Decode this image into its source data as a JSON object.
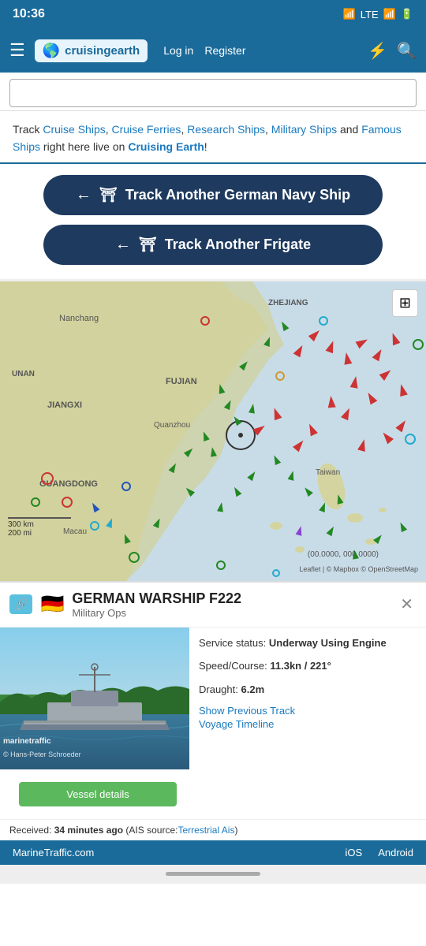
{
  "statusBar": {
    "time": "10:36",
    "bluetooth": "⁸",
    "lte": "LTE",
    "signal": "📶",
    "battery": "🔋"
  },
  "navbar": {
    "logo_text": "cruisingearth",
    "login": "Log in",
    "register": "Register"
  },
  "trackingSection": {
    "prefix": "Track ",
    "links": [
      "Cruise Ships",
      "Cruise Ferries",
      "Research Ships",
      "Military Ships",
      "Famous Ships"
    ],
    "suffix": " right here live on ",
    "brand": "Cruising Earth",
    "postfix": "!"
  },
  "buttons": {
    "german_navy": "Track Another German Navy Ship",
    "frigate": "Track Another Frigate"
  },
  "map": {
    "grid_label": "⊞",
    "scale_300km": "300 km",
    "scale_200mi": "200 mi",
    "coords": "(00.0000, 000.0000)",
    "attribution": "Leaflet | © Mapbox © OpenStreetMap",
    "labels": {
      "nanchang": "Nanchang",
      "zhejiang": "ZHEJIANG",
      "unan": "UNAN",
      "jiangxi": "JIANGXI",
      "fujian": "FUJIAN",
      "guangdong": "GUANGDONG",
      "quanzhou": "Quanzhou",
      "taiwan": "Taiwan",
      "macau": "Macau"
    }
  },
  "ship": {
    "name": "GERMAN WARSHIP F222",
    "category": "Military Ops",
    "service_label": "Service status:",
    "service_value": "Underway Using Engine",
    "speed_label": "Speed/Course:",
    "speed_value": "11.3kn / 221°",
    "draught_label": "Draught:",
    "draught_value": "6.2m",
    "show_track": "Show Previous Track",
    "voyage_timeline": "Voyage Timeline",
    "vessel_details": "Vessel details",
    "received_label": "Received:",
    "received_time": "34 minutes ago",
    "ais_source_prefix": "(AIS source:",
    "ais_source": "Terrestrial Ais",
    "ais_source_suffix": ")",
    "watermark": "marinetraffic",
    "copyright": "© Hans-Peter Schroeder"
  },
  "footer": {
    "site": "MarineTraffic.com",
    "ios": "iOS",
    "android": "Android"
  }
}
